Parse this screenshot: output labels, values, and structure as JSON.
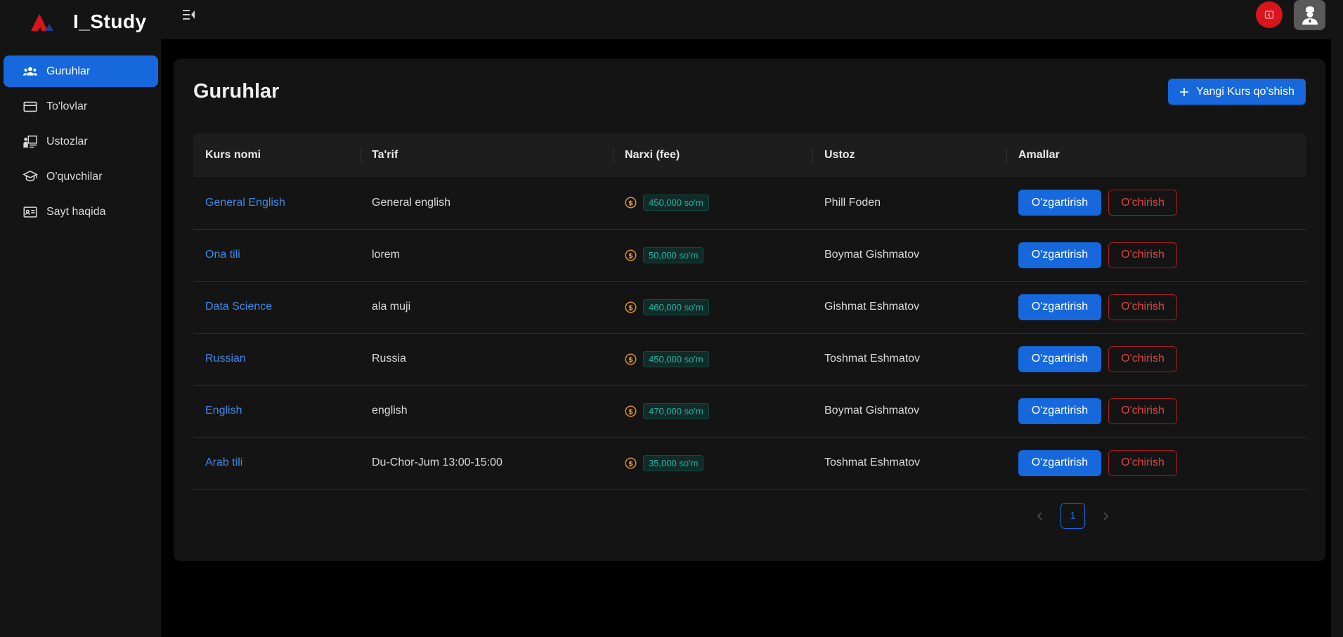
{
  "app": {
    "name": "I_Study"
  },
  "sidebar": {
    "items": [
      {
        "label": "Guruhlar",
        "icon": "users-icon",
        "active": true
      },
      {
        "label": "To'lovlar",
        "icon": "credit-card-icon",
        "active": false
      },
      {
        "label": "Ustozlar",
        "icon": "teacher-icon",
        "active": false
      },
      {
        "label": "O'quvchilar",
        "icon": "graduation-cap-icon",
        "active": false
      },
      {
        "label": "Sayt haqida",
        "icon": "id-card-icon",
        "active": false
      }
    ]
  },
  "header": {
    "menu_icon": "menu-fold-icon",
    "notify_icon": "logout-icon",
    "avatar_icon": "user-avatar-icon"
  },
  "page": {
    "title": "Guruhlar",
    "add_button": "Yangi Kurs qo'shish"
  },
  "table": {
    "columns": [
      "Kurs nomi",
      "Ta'rif",
      "Narxi (fee)",
      "Ustoz",
      "Amallar"
    ],
    "rows": [
      {
        "name": "General English",
        "description": "General english",
        "fee": "450,000 so'm",
        "teacher": "Phill Foden"
      },
      {
        "name": "Ona tili",
        "description": "lorem",
        "fee": "50,000 so'm",
        "teacher": "Boymat Gishmatov"
      },
      {
        "name": "Data Science",
        "description": "ala muji",
        "fee": "460,000 so'm",
        "teacher": "Gishmat Eshmatov"
      },
      {
        "name": "Russian",
        "description": "Russia",
        "fee": "450,000 so'm",
        "teacher": "Toshmat Eshmatov"
      },
      {
        "name": "English",
        "description": "english",
        "fee": "470,000 so'm",
        "teacher": "Boymat Gishmatov"
      },
      {
        "name": "Arab tili",
        "description": "Du-Chor-Jum 13:00-15:00",
        "fee": "35,000 so'm",
        "teacher": "Toshmat Eshmatov"
      }
    ],
    "edit_label": "O'zgartirish",
    "delete_label": "O'chirish"
  },
  "pagination": {
    "current": "1",
    "prev_icon": "chevron-left-icon",
    "next_icon": "chevron-right-icon"
  },
  "colors": {
    "accent": "#1668dc",
    "danger": "#dc4446",
    "fee_text": "#26b5a3",
    "coin": "#e89a3c"
  }
}
